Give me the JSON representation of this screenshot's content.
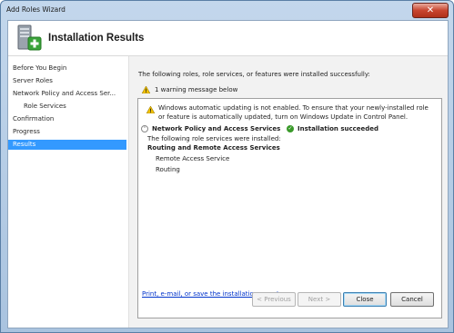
{
  "window": {
    "title": "Add Roles Wizard"
  },
  "header": {
    "title": "Installation Results",
    "icon": "server-add-icon"
  },
  "nav": {
    "items": [
      {
        "label": "Before You Begin"
      },
      {
        "label": "Server Roles"
      },
      {
        "label": "Network Policy and Access Ser..."
      },
      {
        "label": "Role Services"
      },
      {
        "label": "Confirmation"
      },
      {
        "label": "Progress"
      },
      {
        "label": "Results"
      }
    ],
    "active_label": "Results"
  },
  "content": {
    "intro": "The following roles, role services, or features were installed successfully:",
    "warning_summary": "1 warning message below",
    "warning_text": "Windows automatic updating is not enabled. To ensure that your newly-installed role or feature is automatically updated, turn on Windows Update in Control Panel.",
    "role_name": "Network Policy and Access Services",
    "status": "Installation succeeded",
    "installed_intro": "The following role services were installed:",
    "service_group": "Routing and Remote Access Services",
    "services": [
      "Remote Access Service",
      "Routing"
    ],
    "report_link": "Print, e-mail, or save the installation report"
  },
  "buttons": {
    "previous": "< Previous",
    "next": "Next >",
    "close": "Close",
    "cancel": "Cancel"
  },
  "colors": {
    "selection": "#3399ff",
    "link": "#0033cc",
    "success": "#3a9a2a",
    "warning": "#f2c200"
  }
}
